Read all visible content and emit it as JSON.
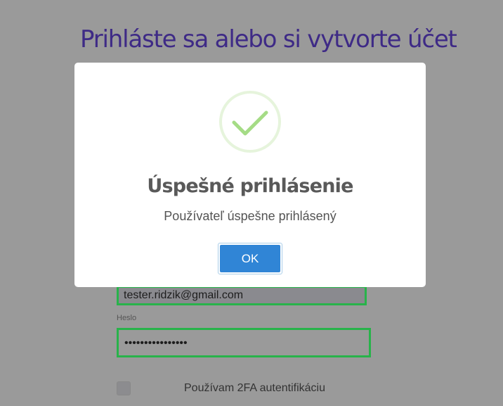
{
  "background": {
    "title": "Prihláste sa alebo si vytvorte účet",
    "email_value": "tester.ridzik@gmail.com",
    "password_label": "Heslo",
    "password_value": "••••••••••••••••",
    "twofa_label": "Používam 2FA autentifikáciu",
    "accent_color": "#28b34a"
  },
  "modal": {
    "icon": "success-check-icon",
    "title": "Úspešné prihlásenie",
    "message": "Používateľ úspešne prihlásený",
    "ok_label": "OK",
    "button_color": "#3085d6"
  }
}
